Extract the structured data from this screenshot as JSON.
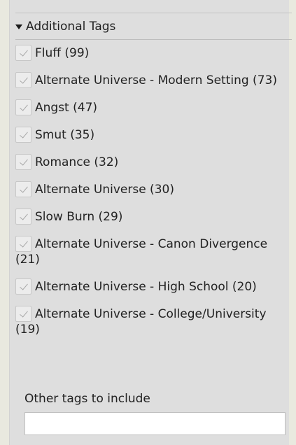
{
  "section": {
    "title": "Additional Tags",
    "expanded": true
  },
  "tags": [
    {
      "label": "Fluff (99)",
      "checked": false
    },
    {
      "label": "Alternate Universe - Modern Setting (73)",
      "checked": false
    },
    {
      "label": "Angst (47)",
      "checked": false
    },
    {
      "label": "Smut (35)",
      "checked": false
    },
    {
      "label": "Romance (32)",
      "checked": false
    },
    {
      "label": "Alternate Universe (30)",
      "checked": false
    },
    {
      "label": "Slow Burn (29)",
      "checked": false
    },
    {
      "label": "Alternate Universe - Canon Divergence (21)",
      "checked": false
    },
    {
      "label": "Alternate Universe - High School (20)",
      "checked": false
    },
    {
      "label": "Alternate Universe - College/University (19)",
      "checked": false
    }
  ],
  "other_tags": {
    "label": "Other tags to include",
    "value": "",
    "placeholder": ""
  },
  "colors": {
    "page_background": "#e9e9df",
    "panel_background": "#dedede",
    "text": "#222222",
    "checkbox_fill": "#ececec"
  },
  "icons": {
    "section_toggle": "triangle-down-icon",
    "checkbox_mark": "checkmark-icon"
  }
}
